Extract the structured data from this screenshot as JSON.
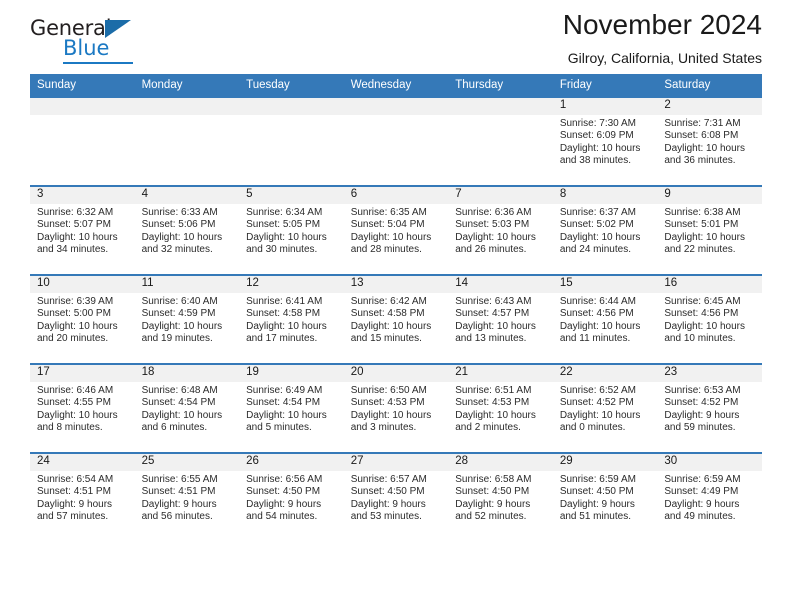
{
  "brand": {
    "name_top": "General",
    "name_bottom": "Blue",
    "accent_color": "#1b79c3"
  },
  "header": {
    "title": "November 2024",
    "subtitle": "Gilroy, California, United States"
  },
  "calendar": {
    "header_bg": "#3579b8",
    "date_band_bg": "#f1f1f1",
    "weekdays": [
      "Sunday",
      "Monday",
      "Tuesday",
      "Wednesday",
      "Thursday",
      "Friday",
      "Saturday"
    ],
    "weeks": [
      [
        {
          "date": "",
          "sunrise": "",
          "sunset": "",
          "daylight": ""
        },
        {
          "date": "",
          "sunrise": "",
          "sunset": "",
          "daylight": ""
        },
        {
          "date": "",
          "sunrise": "",
          "sunset": "",
          "daylight": ""
        },
        {
          "date": "",
          "sunrise": "",
          "sunset": "",
          "daylight": ""
        },
        {
          "date": "",
          "sunrise": "",
          "sunset": "",
          "daylight": ""
        },
        {
          "date": "1",
          "sunrise": "Sunrise: 7:30 AM",
          "sunset": "Sunset: 6:09 PM",
          "daylight": "Daylight: 10 hours and 38 minutes."
        },
        {
          "date": "2",
          "sunrise": "Sunrise: 7:31 AM",
          "sunset": "Sunset: 6:08 PM",
          "daylight": "Daylight: 10 hours and 36 minutes."
        }
      ],
      [
        {
          "date": "3",
          "sunrise": "Sunrise: 6:32 AM",
          "sunset": "Sunset: 5:07 PM",
          "daylight": "Daylight: 10 hours and 34 minutes."
        },
        {
          "date": "4",
          "sunrise": "Sunrise: 6:33 AM",
          "sunset": "Sunset: 5:06 PM",
          "daylight": "Daylight: 10 hours and 32 minutes."
        },
        {
          "date": "5",
          "sunrise": "Sunrise: 6:34 AM",
          "sunset": "Sunset: 5:05 PM",
          "daylight": "Daylight: 10 hours and 30 minutes."
        },
        {
          "date": "6",
          "sunrise": "Sunrise: 6:35 AM",
          "sunset": "Sunset: 5:04 PM",
          "daylight": "Daylight: 10 hours and 28 minutes."
        },
        {
          "date": "7",
          "sunrise": "Sunrise: 6:36 AM",
          "sunset": "Sunset: 5:03 PM",
          "daylight": "Daylight: 10 hours and 26 minutes."
        },
        {
          "date": "8",
          "sunrise": "Sunrise: 6:37 AM",
          "sunset": "Sunset: 5:02 PM",
          "daylight": "Daylight: 10 hours and 24 minutes."
        },
        {
          "date": "9",
          "sunrise": "Sunrise: 6:38 AM",
          "sunset": "Sunset: 5:01 PM",
          "daylight": "Daylight: 10 hours and 22 minutes."
        }
      ],
      [
        {
          "date": "10",
          "sunrise": "Sunrise: 6:39 AM",
          "sunset": "Sunset: 5:00 PM",
          "daylight": "Daylight: 10 hours and 20 minutes."
        },
        {
          "date": "11",
          "sunrise": "Sunrise: 6:40 AM",
          "sunset": "Sunset: 4:59 PM",
          "daylight": "Daylight: 10 hours and 19 minutes."
        },
        {
          "date": "12",
          "sunrise": "Sunrise: 6:41 AM",
          "sunset": "Sunset: 4:58 PM",
          "daylight": "Daylight: 10 hours and 17 minutes."
        },
        {
          "date": "13",
          "sunrise": "Sunrise: 6:42 AM",
          "sunset": "Sunset: 4:58 PM",
          "daylight": "Daylight: 10 hours and 15 minutes."
        },
        {
          "date": "14",
          "sunrise": "Sunrise: 6:43 AM",
          "sunset": "Sunset: 4:57 PM",
          "daylight": "Daylight: 10 hours and 13 minutes."
        },
        {
          "date": "15",
          "sunrise": "Sunrise: 6:44 AM",
          "sunset": "Sunset: 4:56 PM",
          "daylight": "Daylight: 10 hours and 11 minutes."
        },
        {
          "date": "16",
          "sunrise": "Sunrise: 6:45 AM",
          "sunset": "Sunset: 4:56 PM",
          "daylight": "Daylight: 10 hours and 10 minutes."
        }
      ],
      [
        {
          "date": "17",
          "sunrise": "Sunrise: 6:46 AM",
          "sunset": "Sunset: 4:55 PM",
          "daylight": "Daylight: 10 hours and 8 minutes."
        },
        {
          "date": "18",
          "sunrise": "Sunrise: 6:48 AM",
          "sunset": "Sunset: 4:54 PM",
          "daylight": "Daylight: 10 hours and 6 minutes."
        },
        {
          "date": "19",
          "sunrise": "Sunrise: 6:49 AM",
          "sunset": "Sunset: 4:54 PM",
          "daylight": "Daylight: 10 hours and 5 minutes."
        },
        {
          "date": "20",
          "sunrise": "Sunrise: 6:50 AM",
          "sunset": "Sunset: 4:53 PM",
          "daylight": "Daylight: 10 hours and 3 minutes."
        },
        {
          "date": "21",
          "sunrise": "Sunrise: 6:51 AM",
          "sunset": "Sunset: 4:53 PM",
          "daylight": "Daylight: 10 hours and 2 minutes."
        },
        {
          "date": "22",
          "sunrise": "Sunrise: 6:52 AM",
          "sunset": "Sunset: 4:52 PM",
          "daylight": "Daylight: 10 hours and 0 minutes."
        },
        {
          "date": "23",
          "sunrise": "Sunrise: 6:53 AM",
          "sunset": "Sunset: 4:52 PM",
          "daylight": "Daylight: 9 hours and 59 minutes."
        }
      ],
      [
        {
          "date": "24",
          "sunrise": "Sunrise: 6:54 AM",
          "sunset": "Sunset: 4:51 PM",
          "daylight": "Daylight: 9 hours and 57 minutes."
        },
        {
          "date": "25",
          "sunrise": "Sunrise: 6:55 AM",
          "sunset": "Sunset: 4:51 PM",
          "daylight": "Daylight: 9 hours and 56 minutes."
        },
        {
          "date": "26",
          "sunrise": "Sunrise: 6:56 AM",
          "sunset": "Sunset: 4:50 PM",
          "daylight": "Daylight: 9 hours and 54 minutes."
        },
        {
          "date": "27",
          "sunrise": "Sunrise: 6:57 AM",
          "sunset": "Sunset: 4:50 PM",
          "daylight": "Daylight: 9 hours and 53 minutes."
        },
        {
          "date": "28",
          "sunrise": "Sunrise: 6:58 AM",
          "sunset": "Sunset: 4:50 PM",
          "daylight": "Daylight: 9 hours and 52 minutes."
        },
        {
          "date": "29",
          "sunrise": "Sunrise: 6:59 AM",
          "sunset": "Sunset: 4:50 PM",
          "daylight": "Daylight: 9 hours and 51 minutes."
        },
        {
          "date": "30",
          "sunrise": "Sunrise: 6:59 AM",
          "sunset": "Sunset: 4:49 PM",
          "daylight": "Daylight: 9 hours and 49 minutes."
        }
      ]
    ]
  }
}
